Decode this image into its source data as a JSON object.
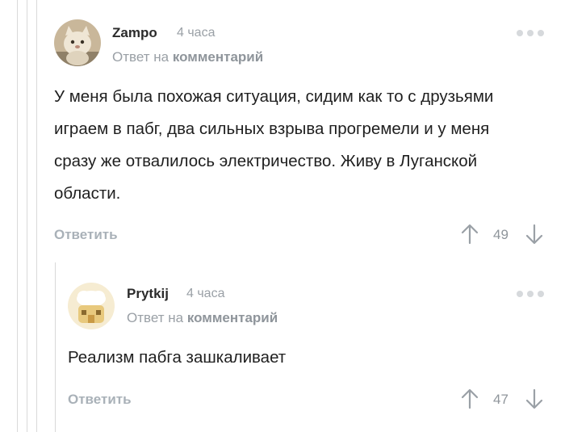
{
  "comment1": {
    "author": "Zampo",
    "time": "4 часа",
    "reply_prefix": "Ответ на",
    "reply_target": "комментарий",
    "text": "У меня была похожая ситуация, сидим как то с друзьями играем в пабг, два сильных взрыва прогремели и у меня сразу же отвалилось электричество. Живу в Луганской области.",
    "reply_label": "Ответить",
    "score": "49",
    "avatar_icon": "cat-avatar-icon"
  },
  "comment2": {
    "author": "Prytkij",
    "time": "4 часа",
    "reply_prefix": "Ответ на",
    "reply_target": "комментарий",
    "text": "Реализм пабга зашкаливает",
    "reply_label": "Ответить",
    "score": "47",
    "avatar_icon": "chef-avatar-icon"
  },
  "colors": {
    "muted": "#9aa0a6",
    "thread_line": "#d9d9d9",
    "dots": "#d6d9dc"
  }
}
